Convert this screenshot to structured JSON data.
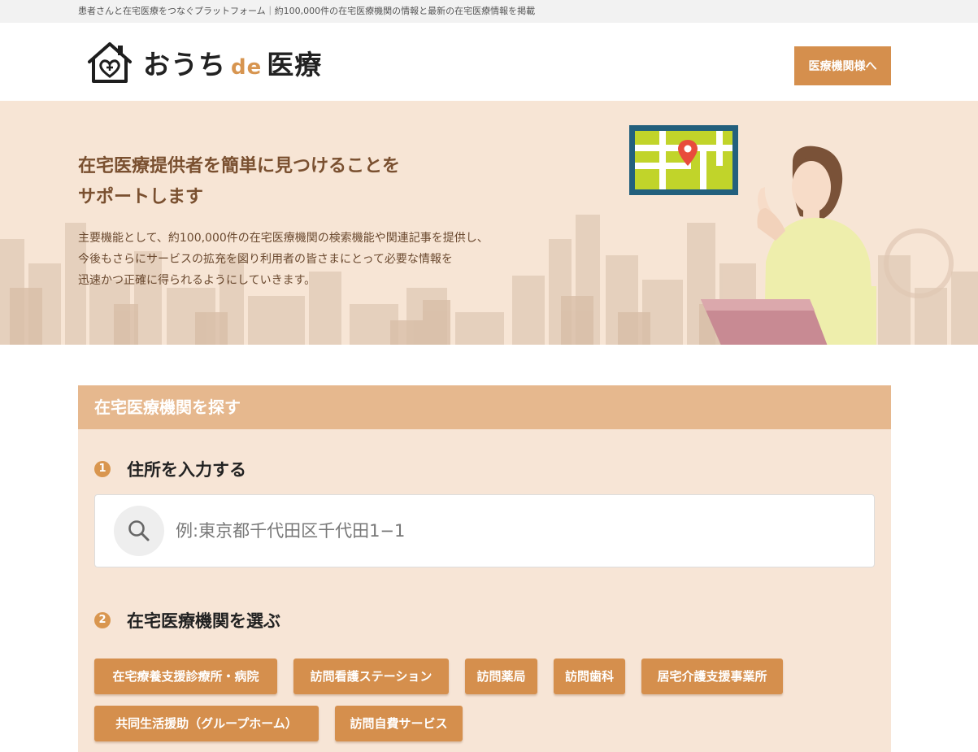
{
  "topbar": {
    "text": "患者さんと在宅医療をつなぐプラットフォーム｜約100,000件の在宅医療機関の情報と最新の在宅医療情報を掲載"
  },
  "logo": {
    "part1": "おうち",
    "part2": "de",
    "part3": "医療"
  },
  "header": {
    "cta_label": "医療機関様へ"
  },
  "hero": {
    "title_line1": "在宅医療提供者を簡単に見つけることを",
    "title_line2": "サポートします",
    "body_line1": "主要機能として、約100,000件の在宅医療機関の検索機能や関連記事を提供し、",
    "body_line2": "今後もさらにサービスの拡充を図り利用者の皆さまにとって必要な情報を",
    "body_line3": "迅速かつ正確に得られるようにしていきます。"
  },
  "search": {
    "heading": "在宅医療機関を探す",
    "step1": {
      "num": "1",
      "label": "住所を入力する"
    },
    "input_placeholder": "例:東京都千代田区千代田1−1",
    "step2": {
      "num": "2",
      "label": "在宅医療機関を選ぶ"
    },
    "categories": [
      "在宅療養支援診療所・病院",
      "訪問看護ステーション",
      "訪問薬局",
      "訪問歯科",
      "居宅介護支援事業所",
      "共同生活援助（グループホーム）",
      "訪問自費サービス"
    ]
  },
  "colors": {
    "accent": "#d58f4d",
    "hero_bg": "#f7e5d5",
    "panel_header": "#e6b88e",
    "heading_brown": "#7a5030"
  },
  "icons": {
    "logo": "house-heart-icon",
    "search": "search-icon"
  }
}
